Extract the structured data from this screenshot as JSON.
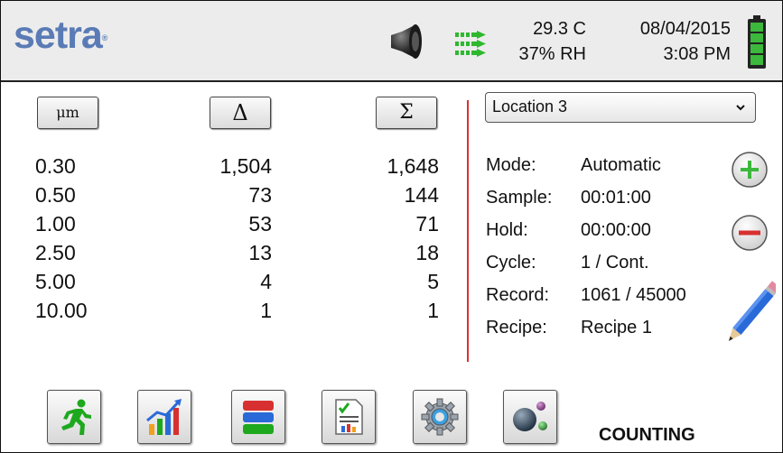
{
  "header": {
    "logo_text": "setra",
    "logo_mark": "®",
    "temperature": "29.3 C",
    "humidity": "37% RH",
    "date": "08/04/2015",
    "time": "3:08 PM",
    "speaker_icon": "speaker-icon",
    "flow_icon": "flow-arrows-icon",
    "battery_icon": "battery-icon",
    "battery_level": 1.0,
    "colors": {
      "logo": "#5a7bb5",
      "flow": "#2eb82e",
      "battery": "#3cb83c"
    }
  },
  "table": {
    "column_buttons": [
      {
        "label": "μm",
        "name": "size-column-button"
      },
      {
        "label": "Δ",
        "name": "delta-column-button"
      },
      {
        "label": "Σ",
        "name": "sigma-column-button"
      }
    ],
    "rows": [
      {
        "size": "0.30",
        "delta": "1,504",
        "sigma": "1,648"
      },
      {
        "size": "0.50",
        "delta": "73",
        "sigma": "144"
      },
      {
        "size": "1.00",
        "delta": "53",
        "sigma": "71"
      },
      {
        "size": "2.50",
        "delta": "13",
        "sigma": "18"
      },
      {
        "size": "5.00",
        "delta": "4",
        "sigma": "5"
      },
      {
        "size": "10.00",
        "delta": "1",
        "sigma": "1"
      }
    ]
  },
  "panel": {
    "location": "Location 3",
    "fields": [
      {
        "label": "Mode:",
        "value": "Automatic"
      },
      {
        "label": "Sample:",
        "value": "00:01:00"
      },
      {
        "label": "Hold:",
        "value": "00:00:00"
      },
      {
        "label": "Cycle:",
        "value": "1 / Cont."
      },
      {
        "label": "Record:",
        "value": "1061 / 45000"
      },
      {
        "label": "Recipe:",
        "value": "Recipe 1"
      }
    ],
    "colors": {
      "divider": "#e03030",
      "plus": "#3cb83c",
      "minus": "#d83030"
    }
  },
  "toolbar": {
    "icons": [
      "running-man-icon",
      "trend-chart-icon",
      "data-layers-icon",
      "report-icon",
      "settings-gear-icon",
      "particles-icon"
    ],
    "status": "COUNTING"
  }
}
